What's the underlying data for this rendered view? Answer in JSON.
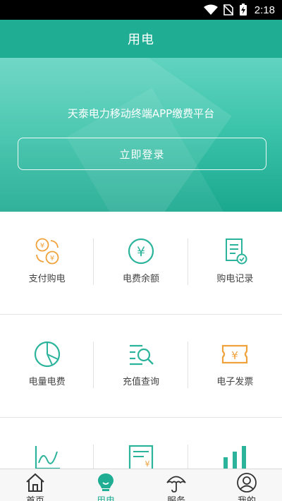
{
  "status_bar": {
    "time": "2:18",
    "icons": [
      "wifi-icon",
      "no-sim-icon",
      "battery-charging-icon"
    ]
  },
  "header": {
    "title": "用电"
  },
  "hero": {
    "subtitle": "天泰电力移动终端APP缴费平台",
    "login_label": "立即登录"
  },
  "colors": {
    "brand": "#1fae93",
    "orange": "#f0a23c",
    "teal": "#2bb39b"
  },
  "grid": {
    "rows": [
      [
        {
          "label": "支付购电",
          "icon": "payment-exchange-icon"
        },
        {
          "label": "电费余额",
          "icon": "yuan-circle-icon"
        },
        {
          "label": "购电记录",
          "icon": "record-document-icon"
        }
      ],
      [
        {
          "label": "电量电费",
          "icon": "pie-chart-icon"
        },
        {
          "label": "充值查询",
          "icon": "search-list-icon"
        },
        {
          "label": "电子发票",
          "icon": "invoice-ticket-icon"
        }
      ],
      [
        {
          "label": "",
          "icon": "line-chart-icon"
        },
        {
          "label": "",
          "icon": "bill-document-icon"
        },
        {
          "label": "",
          "icon": "bar-chart-icon"
        }
      ]
    ]
  },
  "bottom_nav": {
    "items": [
      {
        "label": "首页",
        "icon": "home-icon",
        "active": false
      },
      {
        "label": "用电",
        "icon": "bulb-icon",
        "active": true
      },
      {
        "label": "服务",
        "icon": "umbrella-icon",
        "active": false
      },
      {
        "label": "我的",
        "icon": "user-icon",
        "active": false
      }
    ]
  }
}
